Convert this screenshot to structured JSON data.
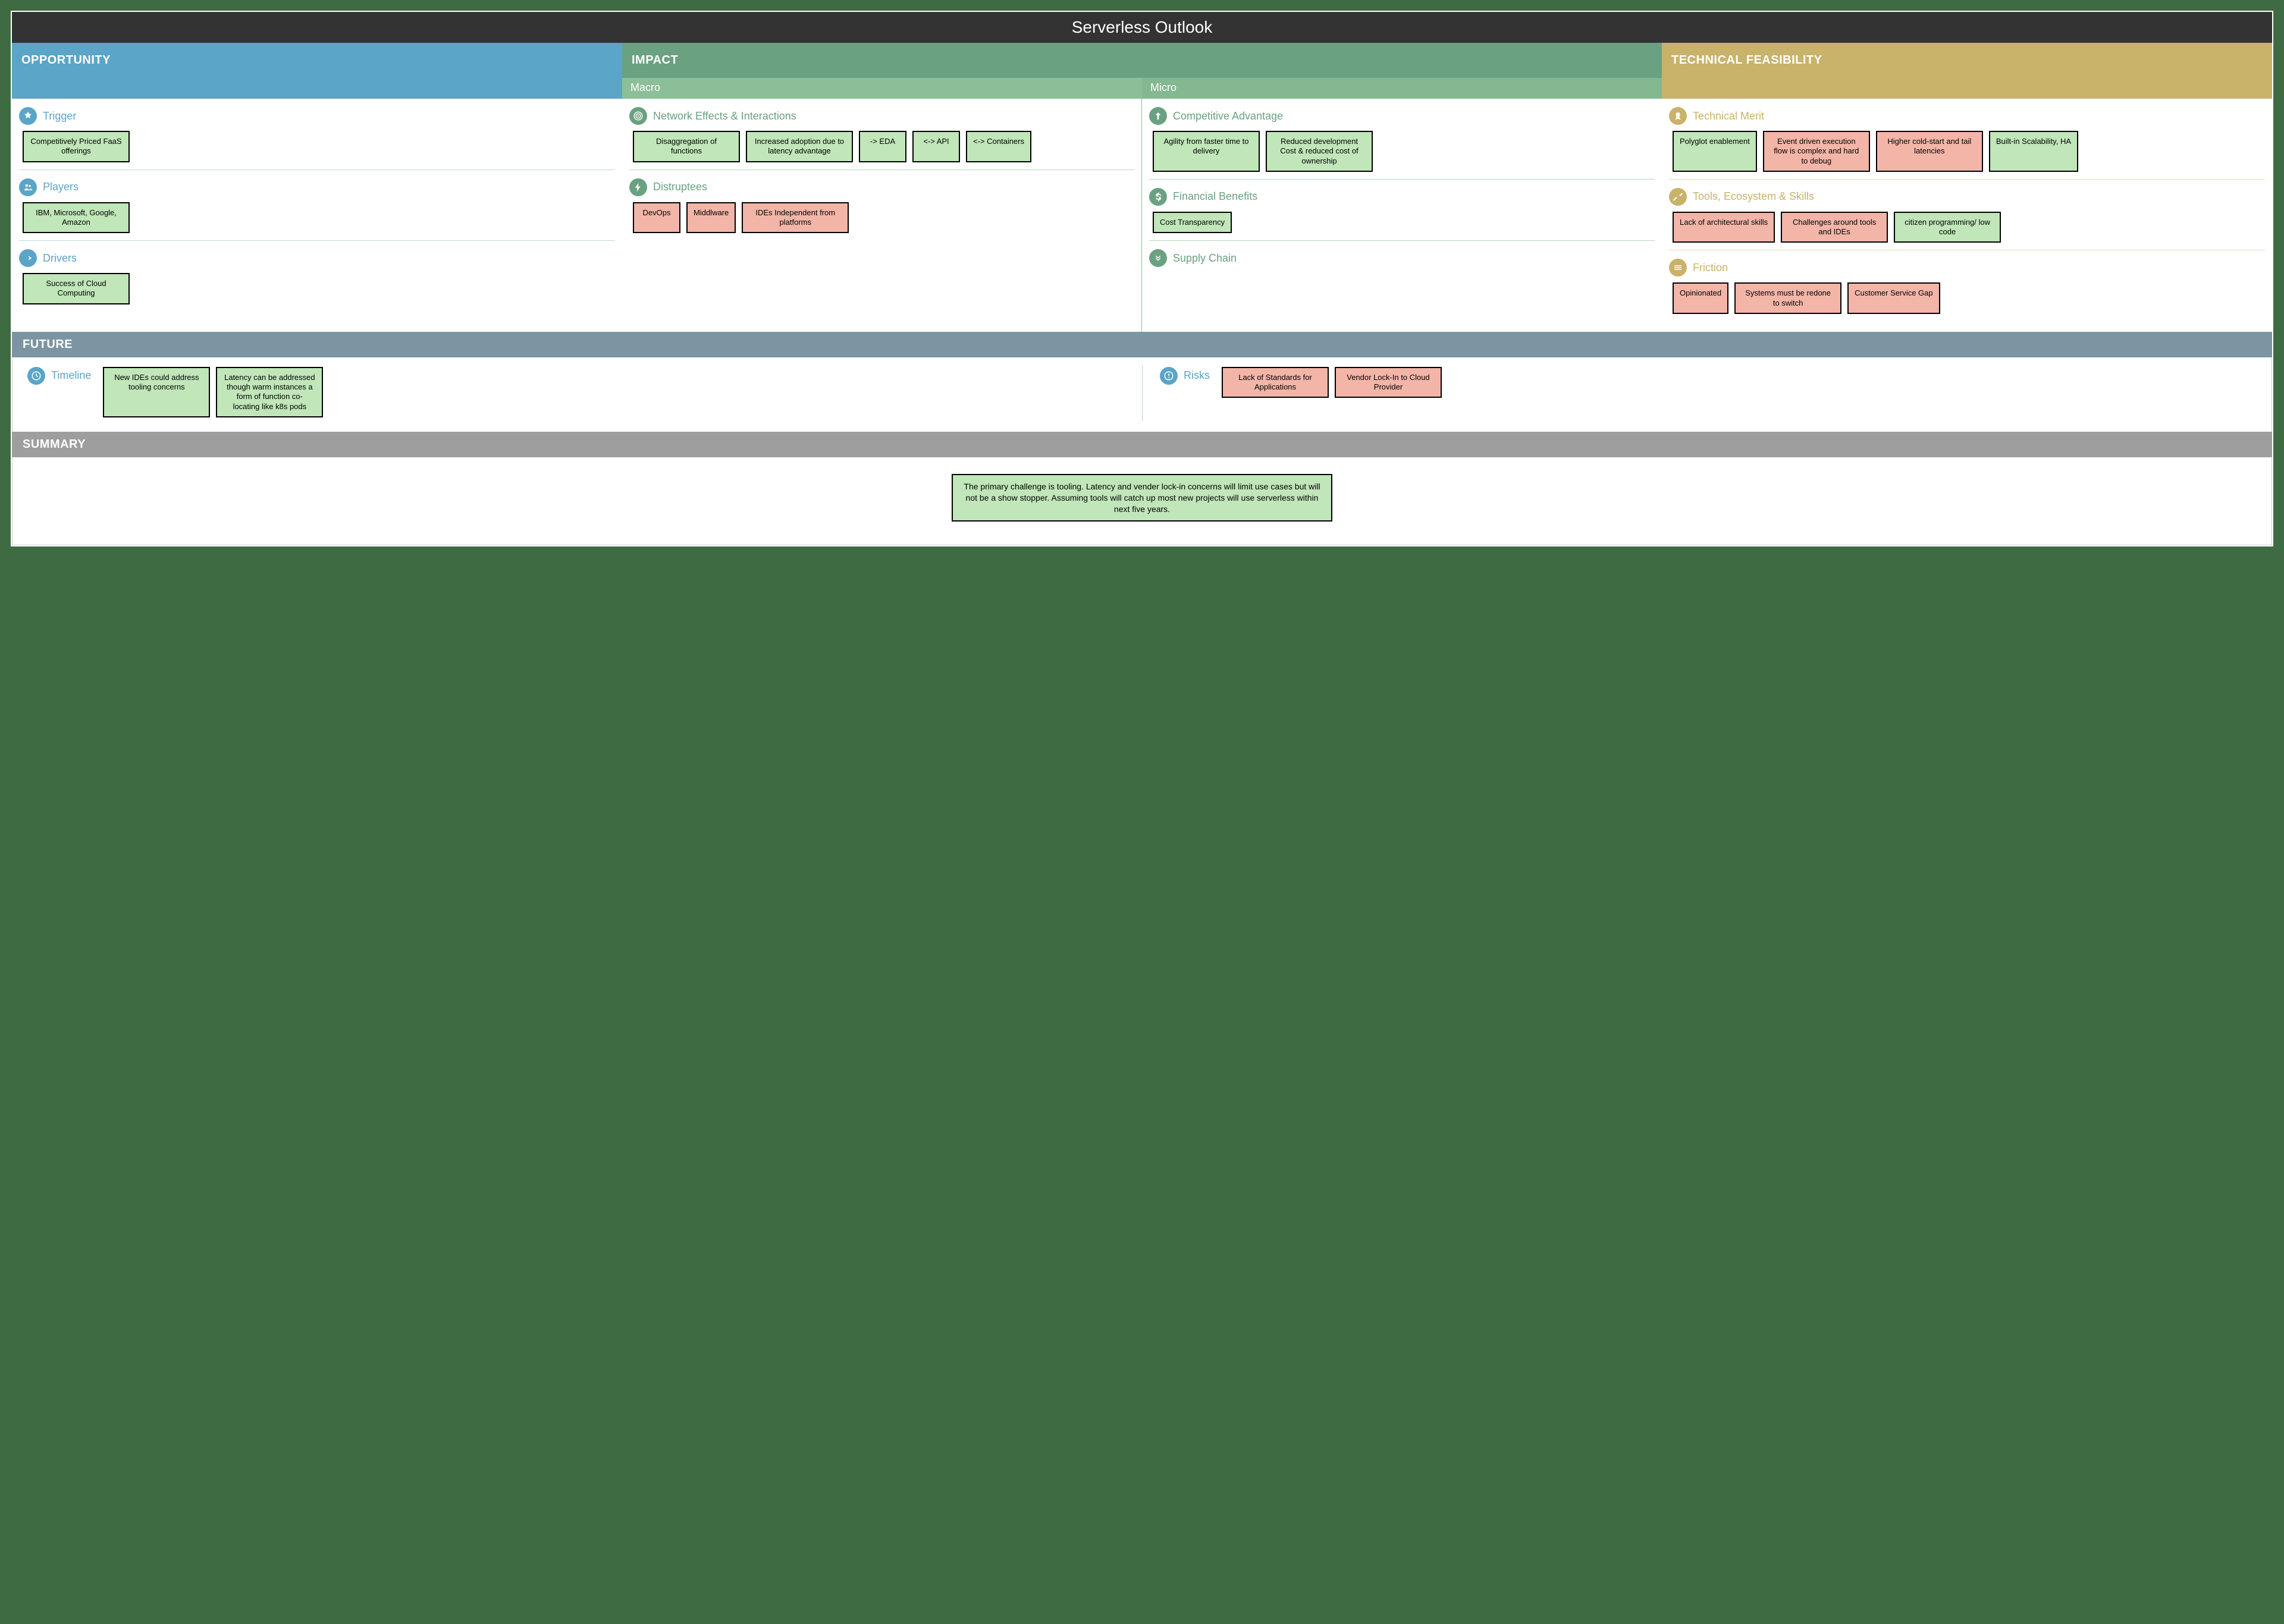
{
  "title": "Serverless Outlook",
  "columns": {
    "opportunity": {
      "header": "OPPORTUNITY",
      "sections": [
        {
          "icon": "star",
          "title": "Trigger",
          "cards": [
            {
              "text": "Competitively Priced FaaS offerings",
              "tone": "pos"
            }
          ]
        },
        {
          "icon": "people",
          "title": "Players",
          "cards": [
            {
              "text": "IBM, Microsoft, Google, Amazon",
              "tone": "pos"
            }
          ]
        },
        {
          "icon": "arrow",
          "title": "Drivers",
          "cards": [
            {
              "text": "Success of Cloud Computing",
              "tone": "pos"
            }
          ]
        }
      ]
    },
    "impact": {
      "header": "IMPACT",
      "macro_label": "Macro",
      "micro_label": "Micro",
      "macro": [
        {
          "icon": "target",
          "title": "Network Effects & Interactions",
          "cards": [
            {
              "text": "Disaggregation of functions",
              "tone": "pos"
            },
            {
              "text": "Increased adoption due to latency advantage",
              "tone": "pos"
            },
            {
              "text": "-> EDA",
              "tone": "pos"
            },
            {
              "text": "<-> API",
              "tone": "pos"
            },
            {
              "text": "<-> Containers",
              "tone": "pos"
            }
          ]
        },
        {
          "icon": "bolt",
          "title": "Distruptees",
          "cards": [
            {
              "text": "DevOps",
              "tone": "neg"
            },
            {
              "text": "Middlware",
              "tone": "neg"
            },
            {
              "text": "IDEs Independent from platforms",
              "tone": "neg"
            }
          ]
        }
      ],
      "micro": [
        {
          "icon": "up",
          "title": "Competitive Advantage",
          "cards": [
            {
              "text": "Agility from faster time to delivery",
              "tone": "pos"
            },
            {
              "text": "Reduced development Cost & reduced cost of ownership",
              "tone": "pos"
            }
          ]
        },
        {
          "icon": "dollar",
          "title": "Financial Benefits",
          "cards": [
            {
              "text": "Cost Transparency",
              "tone": "pos"
            }
          ]
        },
        {
          "icon": "chain",
          "title": "Supply Chain",
          "cards": []
        }
      ]
    },
    "technical": {
      "header": "TECHNICAL FEASIBILITY",
      "sections": [
        {
          "icon": "medal",
          "title": "Technical Merit",
          "cards": [
            {
              "text": "Polyglot enablement",
              "tone": "pos"
            },
            {
              "text": "Event driven execution flow is complex and hard to debug",
              "tone": "neg"
            },
            {
              "text": "Higher cold-start and tail latencies",
              "tone": "neg"
            },
            {
              "text": "Built-in Scalability, HA",
              "tone": "pos"
            }
          ]
        },
        {
          "icon": "tools",
          "title": "Tools, Ecosystem & Skills",
          "cards": [
            {
              "text": "Lack of architectural skills",
              "tone": "neg"
            },
            {
              "text": "Challenges around tools and IDEs",
              "tone": "neg"
            },
            {
              "text": "citizen programming/ low code",
              "tone": "pos"
            }
          ]
        },
        {
          "icon": "friction",
          "title": "Friction",
          "cards": [
            {
              "text": "Opinionated",
              "tone": "neg"
            },
            {
              "text": "Systems must be redone to switch",
              "tone": "neg"
            },
            {
              "text": "Customer Service Gap",
              "tone": "neg"
            }
          ]
        }
      ]
    }
  },
  "future": {
    "header": "FUTURE",
    "timeline": {
      "icon": "clock",
      "title": "Timeline",
      "cards": [
        {
          "text": "New IDEs could address tooling concerns",
          "tone": "pos"
        },
        {
          "text": "Latency can be addressed though warm instances a form of function co-locating like k8s pods",
          "tone": "pos"
        }
      ]
    },
    "risks": {
      "icon": "alert",
      "title": "Risks",
      "cards": [
        {
          "text": "Lack of Standards for Applications",
          "tone": "neg"
        },
        {
          "text": "Vendor Lock-In to Cloud Provider",
          "tone": "neg"
        }
      ]
    }
  },
  "summary": {
    "header": "SUMMARY",
    "text": "The primary challenge is tooling. Latency and vender lock-in concerns will limit use cases but will not be a show stopper. Assuming tools will catch up most new projects will use serverless within next five years."
  }
}
